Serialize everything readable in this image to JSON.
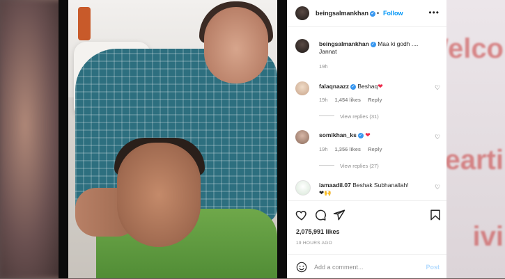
{
  "background": {
    "text_lines": [
      "Welco",
      "earti",
      "ivi"
    ]
  },
  "post_header": {
    "username": "beingsalmankhan",
    "separator": "•",
    "follow_label": "Follow",
    "more_glyph": "•••"
  },
  "caption": {
    "username": "beingsalmankhan",
    "text": "Maa ki godh ....\nJannat",
    "time": "19h"
  },
  "comments": [
    {
      "username": "falaqnaazz",
      "verified": true,
      "text": "Beshaq",
      "heart": "❤",
      "time": "19h",
      "likes": "1,454 likes",
      "reply_label": "Reply",
      "view_replies": "View replies (31)"
    },
    {
      "username": "somikhan_ks",
      "verified": true,
      "text": "",
      "heart": "❤",
      "time": "19h",
      "likes": "1,356 likes",
      "reply_label": "Reply",
      "view_replies": "View replies (27)"
    },
    {
      "username": "iamaadil.07",
      "verified": false,
      "text": "Beshak Subhanallah!",
      "emoji_line": "❤🙌"
    }
  ],
  "actions": {
    "icons": [
      "heart-outline-icon",
      "comment-icon",
      "share-icon",
      "bookmark-icon"
    ]
  },
  "likes_count": "2,075,991 likes",
  "time_ago": "19 HOURS AGO",
  "comment_box": {
    "placeholder": "Add a comment...",
    "post_label": "Post"
  },
  "colors": {
    "link_blue": "#0095f6",
    "verified_blue": "#3897f0",
    "heart_red": "#ed2a4a",
    "post_disabled": "#b3dbff"
  }
}
